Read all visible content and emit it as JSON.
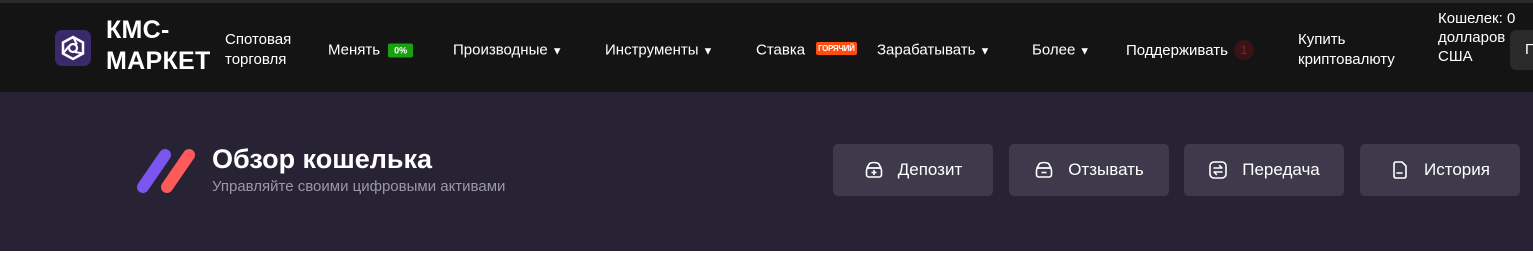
{
  "brand": {
    "name": "КМС-МАРКЕТ"
  },
  "nav": {
    "spot": "Спотовая торговля",
    "exchange": "Менять",
    "exchange_badge": "0%",
    "derivatives": "Производные",
    "tools": "Инструменты",
    "stake": "Ставка",
    "stake_badge": "ГОРЯЧИЙ",
    "earn": "Зарабатывать",
    "more": "Более",
    "support": "Поддерживать",
    "support_count": "1",
    "buy_crypto": "Купить криптовалюту",
    "wallet": "Кошелек: 0 долларов США",
    "edge_button": "П"
  },
  "page": {
    "title": "Обзор кошелька",
    "subtitle": "Управляйте своими цифровыми активами"
  },
  "actions": {
    "deposit": "Депозит",
    "withdraw": "Отзывать",
    "transfer": "Передача",
    "history": "История"
  },
  "colors": {
    "header_bg": "#141414",
    "hero_bg": "#272334",
    "button_bg": "#3e3a4b",
    "accent_purple": "#7b55f0",
    "accent_red": "#ff5a5a",
    "badge_green": "#1aa10f",
    "badge_hot": "#ff4d10"
  },
  "icons": {
    "logo": "hexagon-aperture-icon",
    "deposit": "wallet-plus-icon",
    "withdraw": "wallet-minus-icon",
    "transfer": "transfer-arrows-icon",
    "history": "document-icon"
  }
}
